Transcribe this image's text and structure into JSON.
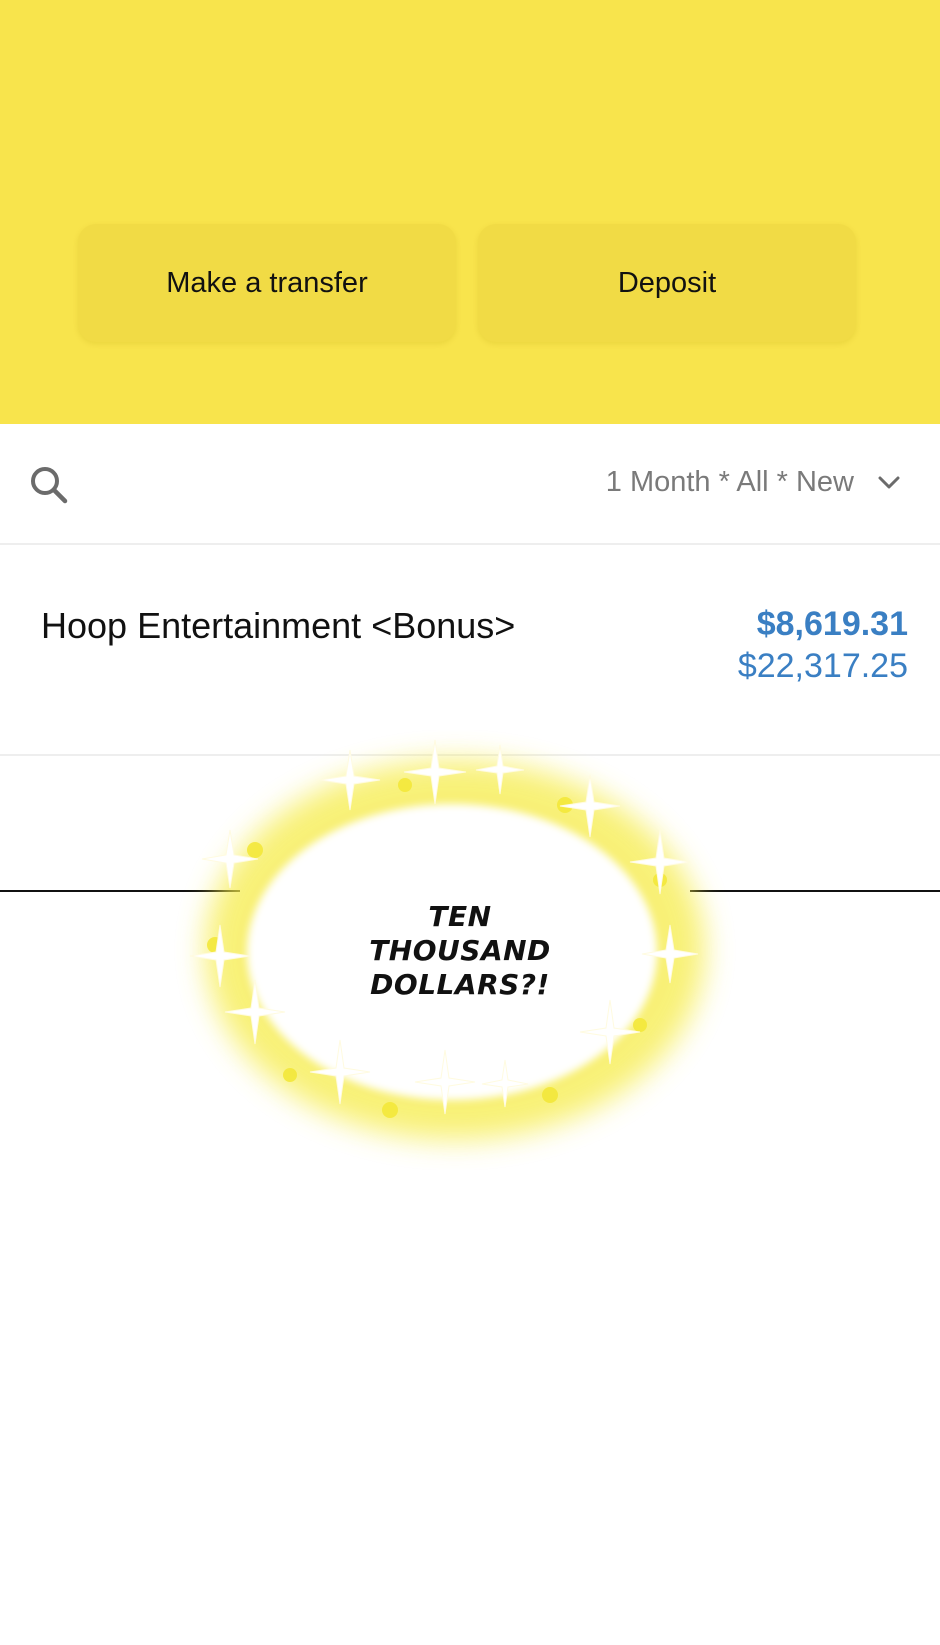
{
  "header": {
    "transfer_label": "Make a transfer",
    "deposit_label": "Deposit",
    "background_color": "#f8e44c"
  },
  "filter": {
    "label": "1 Month * All * New",
    "search_icon": "search-icon",
    "dropdown_icon": "chevron-down-icon"
  },
  "transaction": {
    "name": "Hoop Entertainment <Bonus>",
    "amount": "$8,619.31",
    "balance": "$22,317.25",
    "amount_color": "#3a7fc3"
  },
  "speech_bubble": {
    "text_line1": "TEN",
    "text_line2": "THOUSAND",
    "text_line3": "DOLLARS?!"
  }
}
